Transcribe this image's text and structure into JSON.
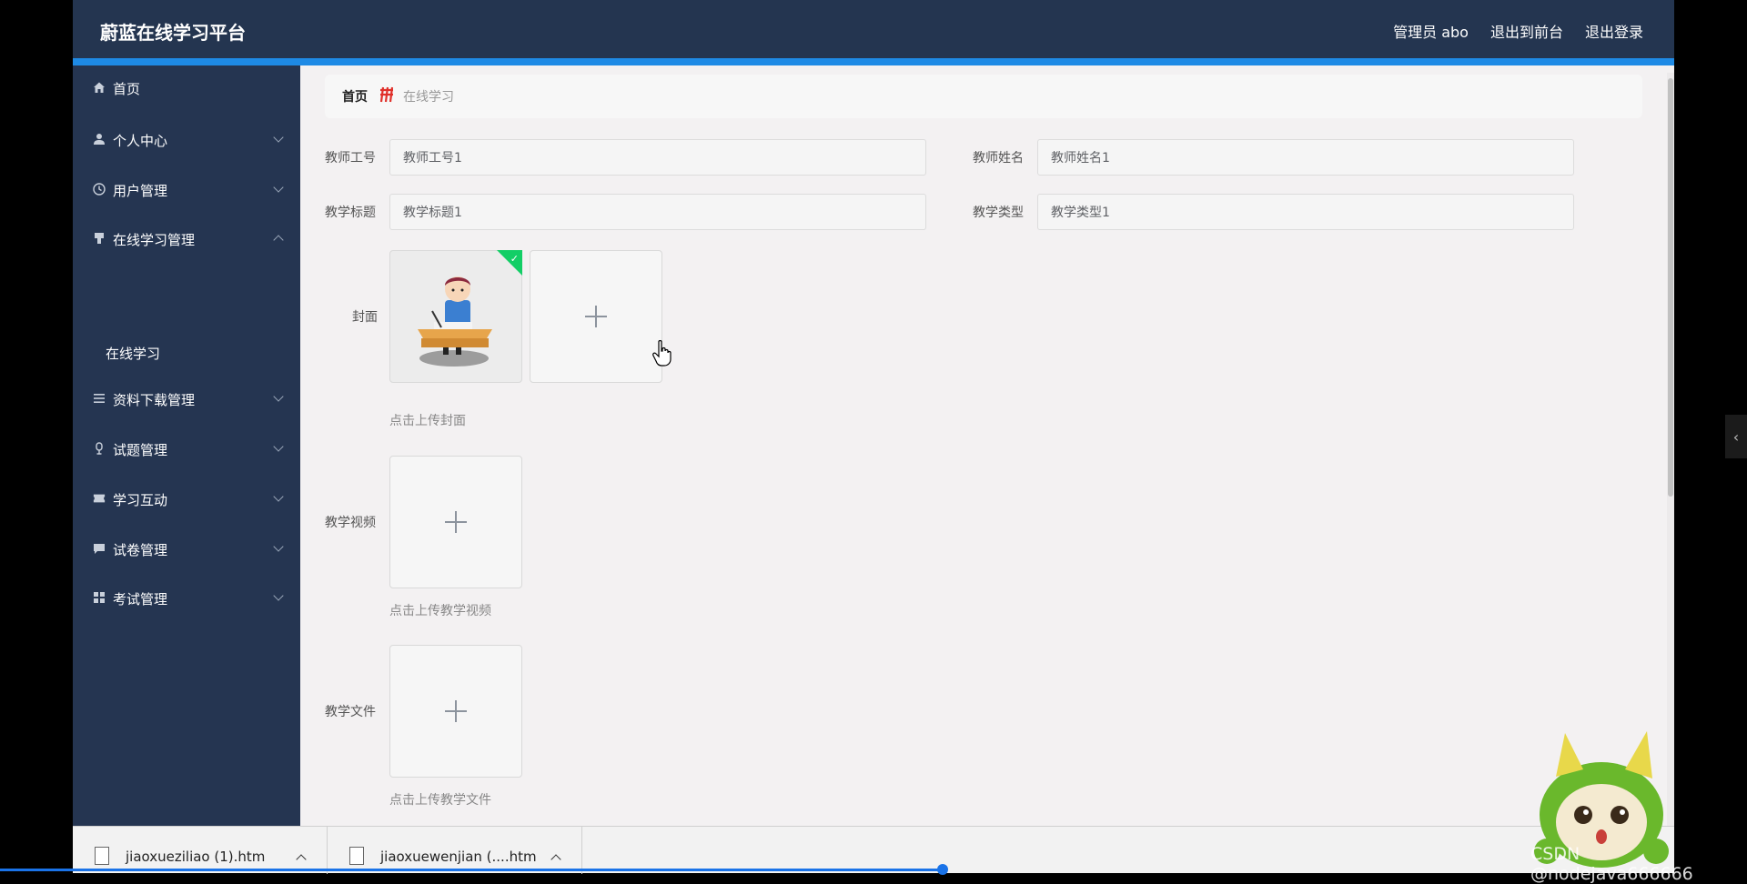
{
  "app": {
    "title": "蔚蓝在线学习平台",
    "user_label": "管理员 abo",
    "to_front_label": "退出到前台",
    "logout_label": "退出登录"
  },
  "sidebar": {
    "items": [
      {
        "label": "首页",
        "icon": "home-icon"
      },
      {
        "label": "个人中心",
        "icon": "user-icon"
      },
      {
        "label": "用户管理",
        "icon": "clock-icon"
      },
      {
        "label": "在线学习管理",
        "icon": "bookmark-icon"
      },
      {
        "label": "资料下载管理",
        "icon": "list-icon"
      },
      {
        "label": "试题管理",
        "icon": "mic-icon"
      },
      {
        "label": "学习互动",
        "icon": "ticket-icon"
      },
      {
        "label": "试卷管理",
        "icon": "chat-icon"
      },
      {
        "label": "考试管理",
        "icon": "grid-icon"
      }
    ],
    "sub_item": "在线学习"
  },
  "breadcrumb": {
    "home": "首页",
    "current": "在线学习"
  },
  "form": {
    "teacher_id_label": "教师工号",
    "teacher_id_value": "教师工号1",
    "teacher_name_label": "教师姓名",
    "teacher_name_value": "教师姓名1",
    "title_label": "教学标题",
    "title_value": "教学标题1",
    "type_label": "教学类型",
    "type_value": "教学类型1",
    "cover_label": "封面",
    "cover_hint": "点击上传封面",
    "video_label": "教学视频",
    "video_hint": "点击上传教学视频",
    "file_label": "教学文件",
    "file_hint": "点击上传教学文件"
  },
  "downloads": [
    {
      "name": "jiaoxueziliao (1).htm"
    },
    {
      "name": "jiaoxuewenjian (....htm"
    }
  ],
  "watermark": "CSDN @nodejava666666",
  "colors": {
    "topbar": "#243550",
    "accent": "#1e8ae5",
    "sidebar": "#253551",
    "success": "#13ce66"
  }
}
